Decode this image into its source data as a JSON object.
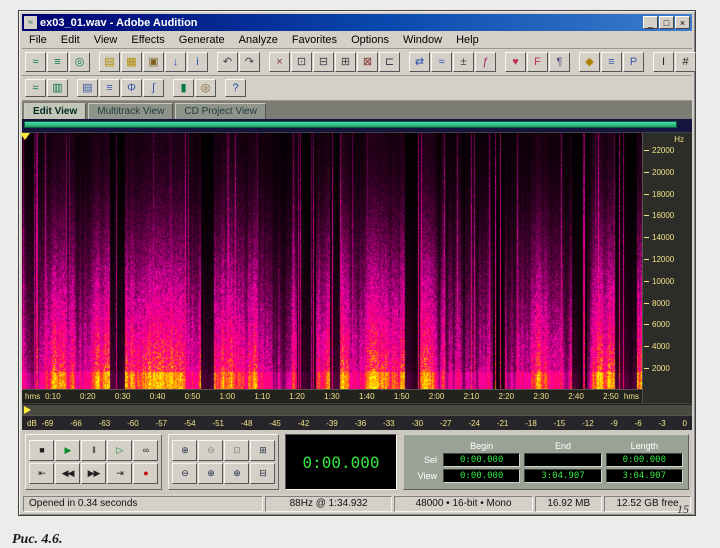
{
  "page": {
    "number": "15",
    "caption_fragment": "Рис. 4.6."
  },
  "window": {
    "title": "ex03_01.wav - Adobe Audition",
    "controls": {
      "minimize": "_",
      "maximize": "□",
      "close": "×"
    },
    "menu": [
      "File",
      "Edit",
      "View",
      "Effects",
      "Generate",
      "Analyze",
      "Favorites",
      "Options",
      "Window",
      "Help"
    ],
    "tabs": [
      "Edit View",
      "Multitrack View",
      "CD Project View"
    ]
  },
  "toolbar_main": [
    {
      "name": "waveform-view-button",
      "glyph": "≈",
      "color": "#0a7a3c"
    },
    {
      "name": "multitrack-view-button",
      "glyph": "≡",
      "color": "#0a7a3c"
    },
    {
      "name": "cd-project-button",
      "glyph": "◎",
      "color": "#0a7a3c"
    },
    {
      "name": "file-new-button",
      "glyph": "▤",
      "color": "#b08a00",
      "gap": true
    },
    {
      "name": "file-open-button",
      "glyph": "▦",
      "color": "#b08a00"
    },
    {
      "name": "file-save-button",
      "glyph": "▣",
      "color": "#806020"
    },
    {
      "name": "file-import-button",
      "glyph": "↓",
      "color": "#2050b0"
    },
    {
      "name": "file-info-button",
      "glyph": "i",
      "color": "#2050b0"
    },
    {
      "name": "undo-button",
      "glyph": "↶",
      "color": "#404048",
      "gap": true
    },
    {
      "name": "redo-button",
      "glyph": "↷",
      "color": "#404048"
    },
    {
      "name": "cut-button",
      "glyph": "×",
      "color": "#803030",
      "gap": true
    },
    {
      "name": "copy-button",
      "glyph": "⊡",
      "color": "#404048"
    },
    {
      "name": "paste-button",
      "glyph": "⊟",
      "color": "#404048"
    },
    {
      "name": "mix-paste-button",
      "glyph": "⊞",
      "color": "#404048"
    },
    {
      "name": "delete-button",
      "glyph": "⊠",
      "color": "#803030"
    },
    {
      "name": "trim-button",
      "glyph": "⊏",
      "color": "#404048"
    },
    {
      "name": "convert-sample-type-button",
      "glyph": "⇄",
      "color": "#2050b0",
      "gap": true
    },
    {
      "name": "normalize-button",
      "glyph": "≈",
      "color": "#2050b0"
    },
    {
      "name": "amplify-button",
      "glyph": "±",
      "color": "#404048"
    },
    {
      "name": "effects-rack-button",
      "glyph": "ƒ",
      "color": "#a02868"
    },
    {
      "name": "favorites-button",
      "glyph": "♥",
      "color": "#c03058",
      "gap": true
    },
    {
      "name": "favorite-f-button",
      "glyph": "F",
      "color": "#c03058"
    },
    {
      "name": "script-button",
      "glyph": "¶",
      "color": "#604890"
    },
    {
      "name": "marker-button",
      "glyph": "◆",
      "color": "#b08000",
      "gap": true
    },
    {
      "name": "mixer-button",
      "glyph": "≡",
      "color": "#3858a8"
    },
    {
      "name": "properties-button",
      "glyph": "P",
      "color": "#3858a8"
    },
    {
      "name": "selection-tool-button",
      "glyph": "I",
      "color": "#202020",
      "gap": true
    },
    {
      "name": "spectral-selection-button",
      "glyph": "#",
      "color": "#202020"
    }
  ],
  "toolbar_secondary": [
    {
      "name": "waveform-display-button",
      "glyph": "≈",
      "color": "#0a7a3c"
    },
    {
      "name": "spectral-display-button",
      "glyph": "▥",
      "color": "#0a7a3c"
    },
    {
      "name": "cue-list-button",
      "glyph": "▤",
      "color": "#3858a8",
      "gap": true
    },
    {
      "name": "play-list-button",
      "glyph": "≡",
      "color": "#3858a8"
    },
    {
      "name": "phase-analysis-button",
      "glyph": "Φ",
      "color": "#3858a8"
    },
    {
      "name": "frequency-analysis-button",
      "glyph": "∫",
      "color": "#3858a8"
    },
    {
      "name": "monitor-record-level-button",
      "glyph": "▮",
      "color": "#0a7a3c",
      "gap": true
    },
    {
      "name": "cd-burn-button",
      "glyph": "◎",
      "color": "#806020"
    },
    {
      "name": "help-button",
      "glyph": "?",
      "color": "#2050b0",
      "gap": true
    }
  ],
  "rulers": {
    "hz_label": "Hz",
    "freq_ticks": [
      "22000",
      "20000",
      "18000",
      "16000",
      "14000",
      "12000",
      "10000",
      "8000",
      "6000",
      "4000",
      "2000"
    ],
    "time_unit": "hms",
    "time_ticks": [
      "0:10",
      "0:20",
      "0:30",
      "0:40",
      "0:50",
      "1:00",
      "1:10",
      "1:20",
      "1:30",
      "1:40",
      "1:50",
      "2:00",
      "2:10",
      "2:20",
      "2:30",
      "2:40",
      "2:50"
    ],
    "db_label": "dB",
    "db_ticks": [
      "-69",
      "-66",
      "-63",
      "-60",
      "-57",
      "-54",
      "-51",
      "-48",
      "-45",
      "-42",
      "-39",
      "-36",
      "-33",
      "-30",
      "-27",
      "-24",
      "-21",
      "-18",
      "-15",
      "-12",
      "-9",
      "-6",
      "-3",
      "0"
    ]
  },
  "transport": {
    "row1": [
      {
        "name": "stop-button",
        "glyph": "■",
        "color": "#202020"
      },
      {
        "name": "play-button",
        "glyph": "▶",
        "color": "#0a8a2a"
      },
      {
        "name": "pause-button",
        "glyph": "‖",
        "color": "#202020"
      },
      {
        "name": "play-to-end-button",
        "glyph": "▷",
        "color": "#0a8a2a"
      },
      {
        "name": "loop-play-button",
        "glyph": "∞",
        "color": "#202020"
      }
    ],
    "row2": [
      {
        "name": "go-to-beginning-button",
        "glyph": "⇤",
        "color": "#202020"
      },
      {
        "name": "rewind-button",
        "glyph": "◀◀",
        "color": "#202020"
      },
      {
        "name": "fast-forward-button",
        "glyph": "▶▶",
        "color": "#202020"
      },
      {
        "name": "go-to-end-button",
        "glyph": "⇥",
        "color": "#202020"
      },
      {
        "name": "record-button",
        "glyph": "●",
        "color": "#c41010"
      }
    ]
  },
  "zoom": {
    "row1": [
      {
        "name": "zoom-in-button",
        "glyph": "⊕",
        "color": "#203048"
      },
      {
        "name": "zoom-out-button",
        "glyph": "⊖",
        "color": "#203048",
        "disabled": true
      },
      {
        "name": "zoom-full-button",
        "glyph": "⊡",
        "color": "#203048",
        "disabled": true
      },
      {
        "name": "zoom-to-window-button",
        "glyph": "⊞",
        "color": "#203048"
      }
    ],
    "row2": [
      {
        "name": "zoom-out-full-button",
        "glyph": "⊖",
        "color": "#203048"
      },
      {
        "name": "zoom-selection-left-button",
        "glyph": "⊕",
        "color": "#203048"
      },
      {
        "name": "zoom-selection-right-button",
        "glyph": "⊕",
        "color": "#203048"
      },
      {
        "name": "zoom-vertical-button",
        "glyph": "⊟",
        "color": "#203048"
      }
    ]
  },
  "time_display": "0:00.000",
  "selection": {
    "headers": [
      "Begin",
      "End",
      "Length"
    ],
    "rows": [
      {
        "label": "Sel",
        "begin": "0:00.000",
        "end": "",
        "length": "0:00.000"
      },
      {
        "label": "View",
        "begin": "0:00.000",
        "end": "3:04.907",
        "length": "3:04.907"
      }
    ]
  },
  "status": [
    "Opened in 0.34 seconds",
    "88Hz @ 1:34.932",
    "48000 • 16-bit • Mono",
    "16.92 MB",
    "12.52 GB free"
  ]
}
